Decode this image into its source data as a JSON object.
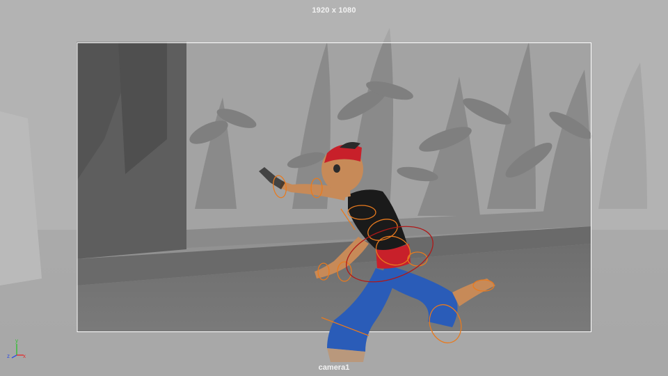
{
  "viewport": {
    "resolution_label": "1920 x 1080",
    "camera_label": "camera1"
  },
  "axis_indicator": {
    "x_label": "x",
    "y_label": "y",
    "z_label": "z",
    "x_color": "#e03030",
    "y_color": "#30c030",
    "z_color": "#3050e0"
  },
  "colors": {
    "control_curve": "#e87a1e",
    "control_curve_root": "#b01818",
    "gate_frame": "#ffffff",
    "headband": "#c8202a",
    "pants": "#2a5cb8",
    "shirt": "#1a1a1a",
    "skin": "#c78a58"
  }
}
